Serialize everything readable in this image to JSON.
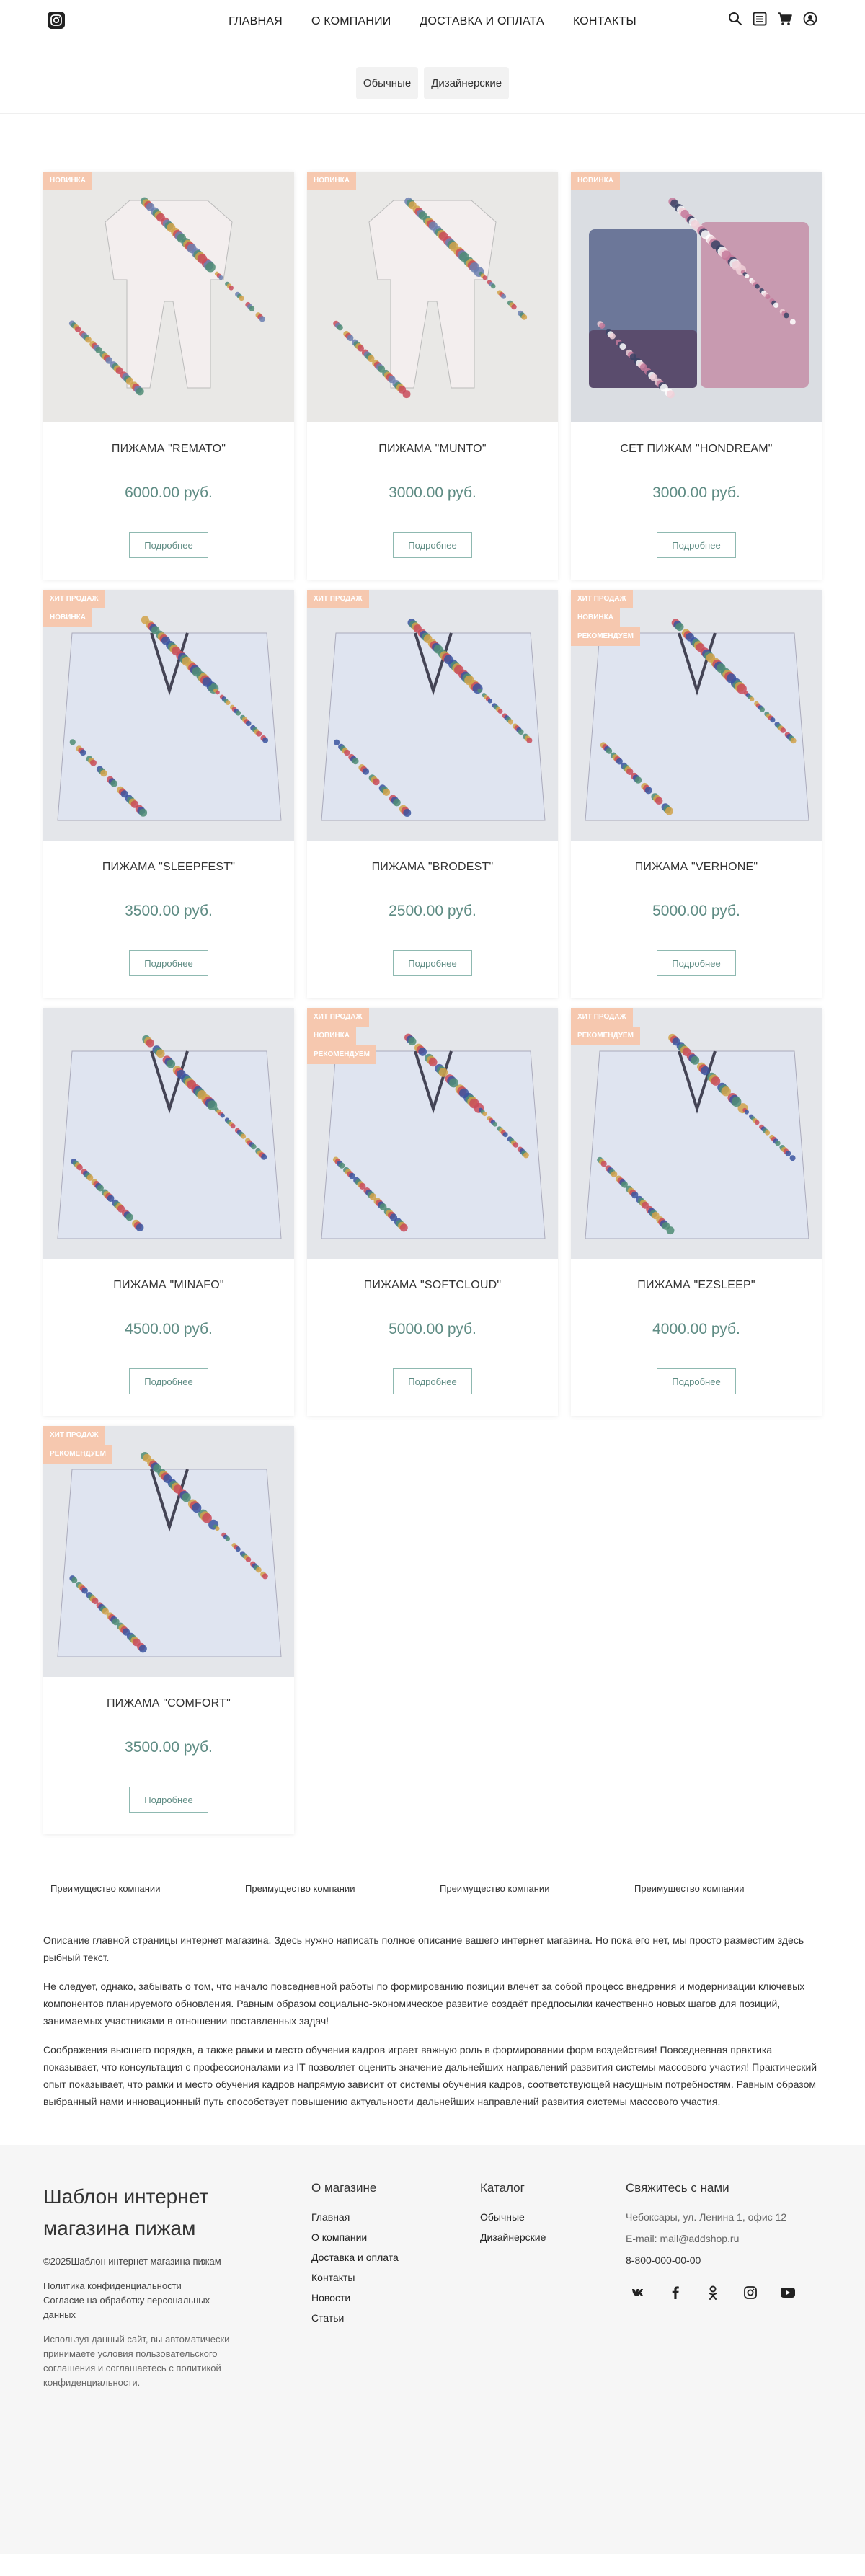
{
  "header": {
    "nav": [
      "ГЛАВНАЯ",
      "О КОМПАНИИ",
      "ДОСТАВКА И ОПЛАТА",
      "КОНТАКТЫ"
    ]
  },
  "categories": [
    "Обычные",
    "Дизайнерские"
  ],
  "products": [
    {
      "title": "ПИЖАМА \"REMATO\"",
      "price": "6000.00 руб.",
      "badges": [
        "НОВИНКА"
      ],
      "image": "pajama-set-hanging"
    },
    {
      "title": "ПИЖАМА \"MUNTO\"",
      "price": "3000.00 руб.",
      "badges": [
        "НОВИНКА"
      ],
      "image": "pajama-set-hanging"
    },
    {
      "title": "СЕТ ПИЖАМ \"HONDREAM\"",
      "price": "3000.00 руб.",
      "badges": [
        "НОВИНКА"
      ],
      "image": "pajama-stack"
    },
    {
      "title": "ПИЖАМА \"SLEEPFEST\"",
      "price": "3500.00 руб.",
      "badges": [
        "ХИТ ПРОДАЖ",
        "НОВИНКА"
      ],
      "image": "pajama-folded"
    },
    {
      "title": "ПИЖАМА \"BRODEST\"",
      "price": "2500.00 руб.",
      "badges": [
        "ХИТ ПРОДАЖ"
      ],
      "image": "pajama-folded"
    },
    {
      "title": "ПИЖАМА \"VERHONE\"",
      "price": "5000.00 руб.",
      "badges": [
        "ХИТ ПРОДАЖ",
        "НОВИНКА",
        "РЕКОМЕНДУЕМ"
      ],
      "image": "pajama-folded"
    },
    {
      "title": "ПИЖАМА \"MINAFO\"",
      "price": "4500.00 руб.",
      "badges": [],
      "image": "pajama-folded"
    },
    {
      "title": "ПИЖАМА \"SOFTCLOUD\"",
      "price": "5000.00 руб.",
      "badges": [
        "ХИТ ПРОДАЖ",
        "НОВИНКА",
        "РЕКОМЕНДУЕМ"
      ],
      "image": "pajama-folded"
    },
    {
      "title": "ПИЖАМА \"EZSLEEP\"",
      "price": "4000.00 руб.",
      "badges": [
        "ХИТ ПРОДАЖ",
        "РЕКОМЕНДУЕМ"
      ],
      "image": "pajama-folded"
    },
    {
      "title": "ПИЖАМА \"COMFORT\"",
      "price": "3500.00 руб.",
      "badges": [
        "ХИТ ПРОДАЖ",
        "РЕКОМЕНДУЕМ"
      ],
      "image": "pajama-folded"
    }
  ],
  "more_label": "Подробнее",
  "advantages": [
    "Преимущество компании",
    "Преимущество компании",
    "Преимущество компании",
    "Преимущество компании"
  ],
  "description": [
    "Описание главной страницы интернет магазина. Здесь нужно написать полное описание вашего интернет магазина. Но пока его нет, мы просто разместим здесь рыбный текст.",
    "Не следует, однако, забывать о том, что начало повседневной работы по формированию позиции влечет за собой процесс внедрения и модернизации ключевых компонентов планируемого обновления. Равным образом социально-экономическое развитие создаёт предпосылки качественно новых шагов для позиций, занимаемых участниками в отношении поставленных задач!",
    "Соображения высшего порядка, а также рамки и место обучения кадров играет важную роль в формировании форм воздействия! Повседневная практика показывает, что консультация с профессионалами из IT позволяет оценить значение дальнейших направлений развития системы массового участия! Практический опыт показывает, что рамки и место обучения кадров напрямую зависит от системы обучения кадров, соответствующей насущным потребностям. Равным образом выбранный нами инновационный путь способствует повышению актуальности дальнейших направлений развития системы массового участия."
  ],
  "footer": {
    "brand": "Шаблон интернет магазина пижам",
    "copyright": "©2025Шаблон интернет магазина пижам",
    "privacy": "Политика конфиденциальности",
    "consent": "Согласие на обработку персональных данных",
    "notice": "Используя данный сайт, вы автоматически принимаете условия пользовательского соглашения и соглашаетесь с политикой конфиденциальности.",
    "about_title": "О магазине",
    "about_links": [
      "Главная",
      "О компании",
      "Доставка и оплата",
      "Контакты",
      "Новости",
      "Статьи"
    ],
    "catalog_title": "Каталог",
    "catalog_links": [
      "Обычные",
      "Дизайнерские"
    ],
    "contact_title": "Свяжитесь с нами",
    "address": "Чебоксары, ул. Ленина 1, офис 12",
    "email": "E-mail: mail@addshop.ru",
    "phone": "8-800-000-00-00",
    "social": [
      "vk-icon",
      "facebook-icon",
      "odnoklassniki-icon",
      "instagram-icon",
      "youtube-icon"
    ]
  },
  "colors": {
    "accent": "#5f8c84",
    "badge": "#f6c8af",
    "footer_bg": "#f6f6f6"
  }
}
